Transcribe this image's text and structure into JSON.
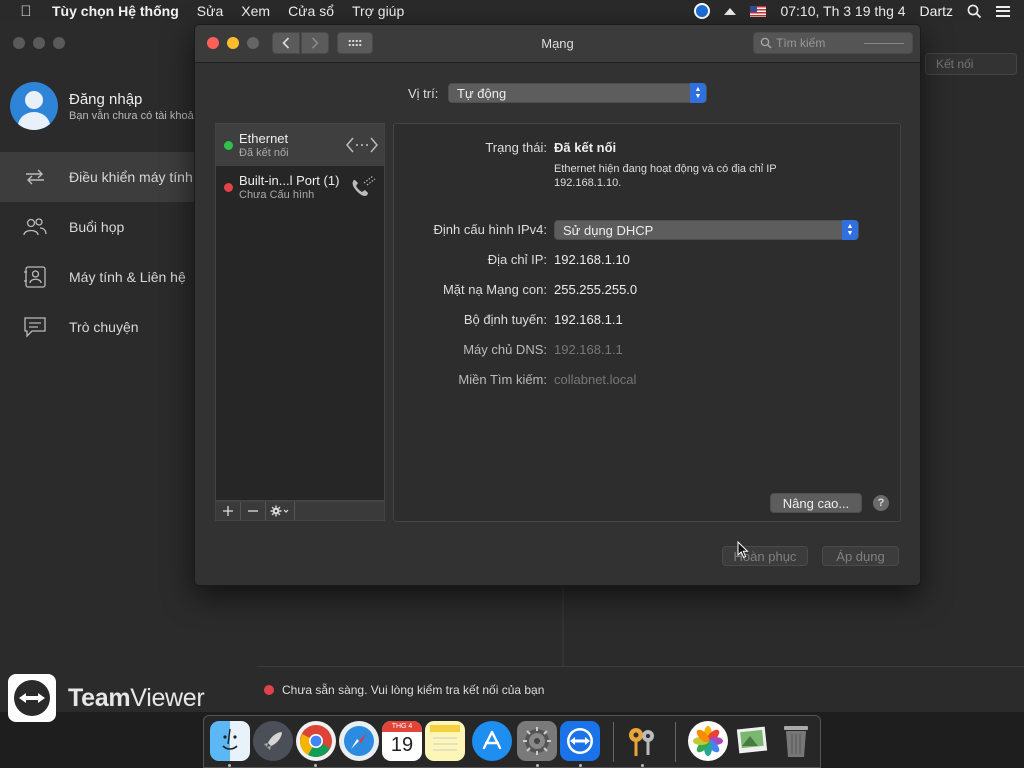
{
  "menubar": {
    "app_name": "Tùy chọn Hệ thống",
    "items": [
      "Sửa",
      "Xem",
      "Cửa sổ",
      "Trợ giúp"
    ],
    "datetime": "07:10, Th 3 19 thg 4",
    "user": "Dartz"
  },
  "teamviewer": {
    "login_title": "Đăng nhập",
    "login_subtitle": "Bạn vẫn chưa có tài khoản",
    "nav": [
      {
        "label": "Điều khiển máy tính từ xa",
        "icon": "arrows-swap-icon"
      },
      {
        "label": "Buổi họp",
        "icon": "people-icon"
      },
      {
        "label": "Máy tính & Liên hệ",
        "icon": "contacts-icon"
      },
      {
        "label": "Trò chuyện",
        "icon": "chat-icon"
      }
    ],
    "connect_label": "Kết nối",
    "brand_bold": "Team",
    "brand_rest": "Viewer",
    "status_text": "Chưa sẵn sàng. Vui lòng kiểm tra kết nối của bạn"
  },
  "network": {
    "title": "Mạng",
    "search_placeholder": "Tìm kiếm",
    "location_label": "Vị trí:",
    "location_value": "Tự động",
    "services": [
      {
        "name": "Ethernet",
        "status": "Đã kết nối",
        "color": "#2ec24a"
      },
      {
        "name": "Built-in...l Port (1)",
        "status": "Chưa Cấu hình",
        "color": "#e2424a"
      }
    ],
    "status_label": "Trạng thái:",
    "status_value": "Đã kết nối",
    "status_desc_line1": "Ethernet hiện đang hoạt động và có địa chỉ IP",
    "status_desc_line2": "192.168.1.10.",
    "ipv4_label": "Định cấu hình IPv4:",
    "ipv4_value": "Sử dụng DHCP",
    "ip_label": "Địa chỉ IP:",
    "ip_value": "192.168.1.10",
    "subnet_label": "Mặt nạ Mạng con:",
    "subnet_value": "255.255.255.0",
    "router_label": "Bộ định tuyến:",
    "router_value": "192.168.1.1",
    "dns_label": "Máy chủ DNS:",
    "dns_value": "192.168.1.1",
    "search_domain_label": "Miền Tìm kiếm:",
    "search_domain_value": "collabnet.local",
    "advanced_label": "Nâng cao...",
    "help_label": "?",
    "revert_label": "Hoàn phục",
    "apply_label": "Áp dụng"
  },
  "dock": {
    "calendar_month": "THG 4",
    "calendar_day": "19"
  }
}
